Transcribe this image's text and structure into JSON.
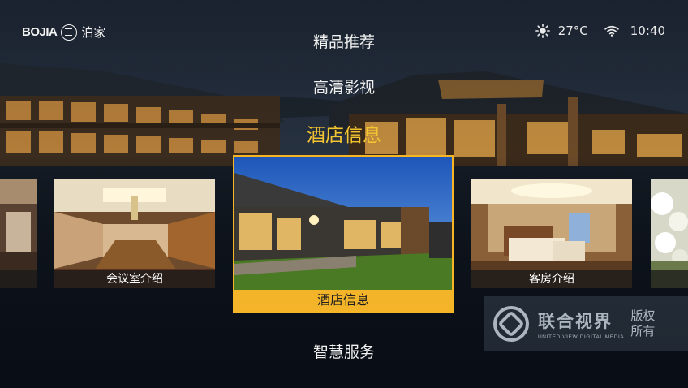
{
  "brand": {
    "latin": "BOJIA",
    "chinese": "泊家"
  },
  "status": {
    "temperature": "27°C",
    "time": "10:40",
    "weather_icon": "sun-icon",
    "network_icon": "wifi-icon"
  },
  "menu": {
    "items": [
      {
        "label": "精品推荐"
      },
      {
        "label": "高清影视"
      },
      {
        "label": "酒店信息",
        "active": true
      },
      {
        "label": "智慧服务"
      }
    ]
  },
  "cards": {
    "meeting": {
      "label": "会议室介绍"
    },
    "hotel": {
      "label": "酒店信息"
    },
    "room": {
      "label": "客房介绍"
    }
  },
  "watermark": {
    "title": "联合视界",
    "subtitle": "UNITED VIEW DIGITAL MEDIA",
    "rights_line1": "版权",
    "rights_line2": "所有"
  },
  "colors": {
    "accent": "#f5c431",
    "focus_bar": "#f3b42a",
    "background": "#0c1522"
  }
}
